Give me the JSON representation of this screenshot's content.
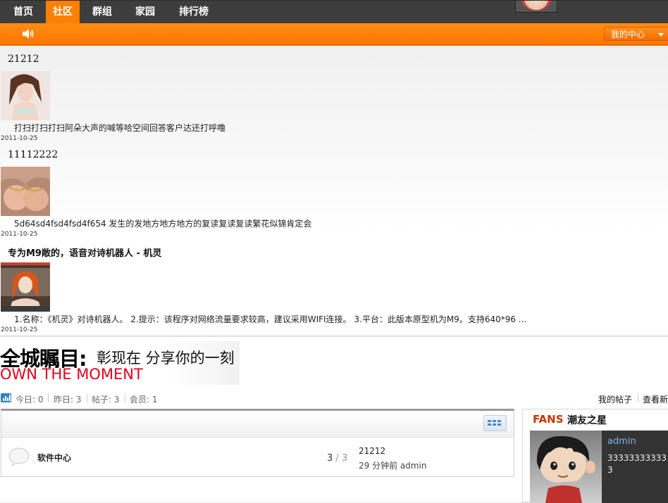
{
  "nav": {
    "items": [
      {
        "label": "首页",
        "active": false
      },
      {
        "label": "社区",
        "active": true
      },
      {
        "label": "群组",
        "active": false
      },
      {
        "label": "家园",
        "active": false
      },
      {
        "label": "排行榜",
        "active": false
      }
    ],
    "accent_color": "#ff7f00",
    "bar_color": "#3d3d3d"
  },
  "subbar": {
    "speaker_icon": "speaker-icon",
    "my_center_label": "我的中心"
  },
  "posts": [
    {
      "title": "21212",
      "text": "打扫打扫打扫阿朵大声的喊等哈空间回答客户达还打呼噜",
      "date": "2011-10-25"
    },
    {
      "title": "11112222",
      "text": "5d64sd4fsd4fsd4f654 发生的发地方地方地方的复读复读复读繁花似锦肯定会",
      "date": "2011-10-25"
    },
    {
      "title": "专为M9敞的，语音对诗机器人 - 机灵",
      "text": "1.名称：《机灵》对诗机器人。 2.提示：该程序对网络流量要求较高，建议采用WIFI连接。 3.平台：此版本原型机为M9。支持640*96 ...",
      "date": "2011-10-25"
    }
  ],
  "banner": {
    "headline": "全城瞩目:",
    "subline": "彰现在 分享你的一刻",
    "english": "OWN THE MOMENT"
  },
  "stats": {
    "today": "今日: 0",
    "yesterday": "昨日: 3",
    "posts": "帖子: 3",
    "members": "会员: 1",
    "my_posts": "我的帖子",
    "view_new": "查看新"
  },
  "forum": {
    "name": "软件中心",
    "count_today": "3",
    "count_sep": " / ",
    "count_total": "3",
    "last_title": "21212",
    "last_meta": "29 分钟前 admin"
  },
  "fans": {
    "label": "FANS",
    "title": "潮友之星",
    "username": "admin",
    "value": "333333333333"
  }
}
